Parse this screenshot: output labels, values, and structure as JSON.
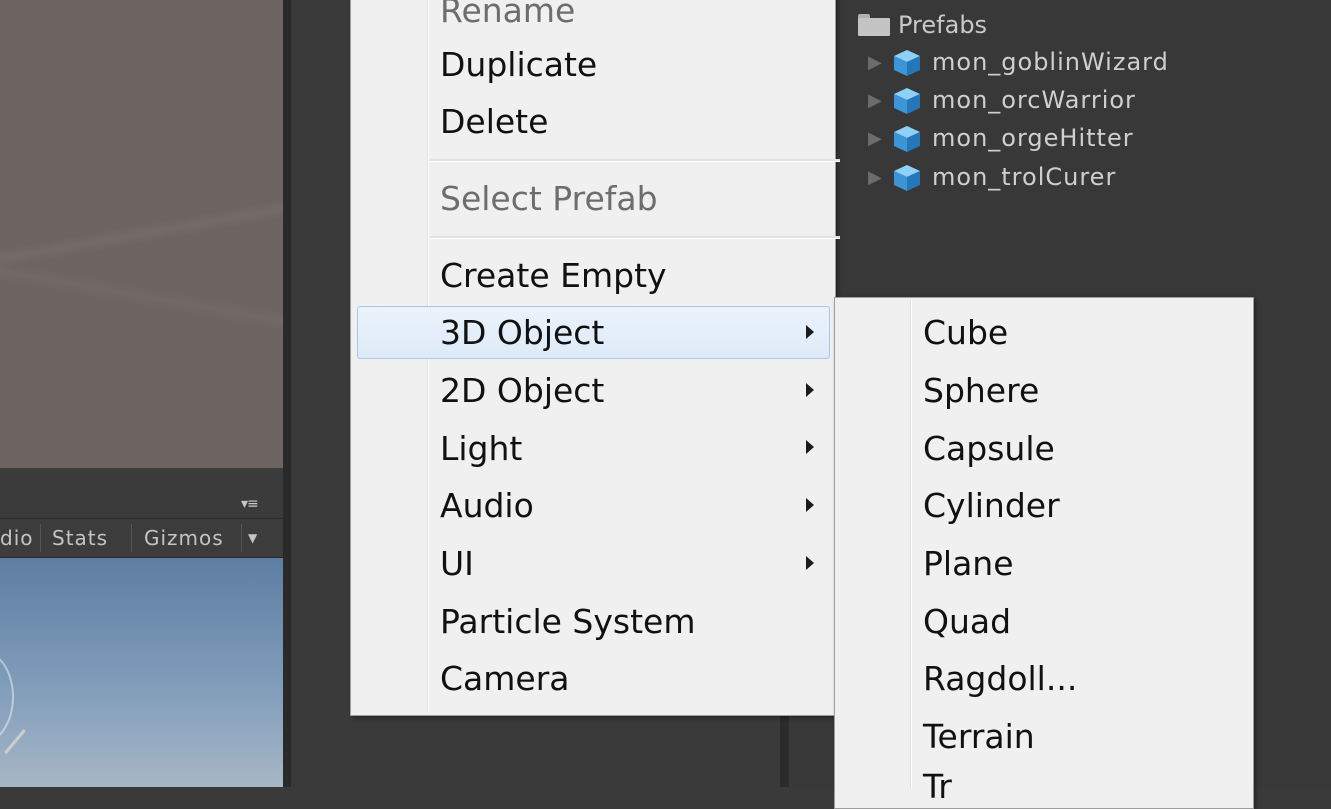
{
  "scene": {
    "toolbar": {
      "audio_partial": "dio",
      "stats_label": "Stats",
      "gizmos_label": "Gizmos"
    }
  },
  "hierarchy": {
    "folder_label": "Prefabs",
    "items": [
      {
        "label": "mon_goblinWizard"
      },
      {
        "label": "mon_orcWarrior"
      },
      {
        "label": "mon_orgeHitter"
      },
      {
        "label": "mon_trolCurer"
      }
    ]
  },
  "context_menu": {
    "rename": "Rename",
    "duplicate": "Duplicate",
    "delete": "Delete",
    "select_prefab": "Select Prefab",
    "create_empty": "Create Empty",
    "object_3d": "3D Object",
    "object_2d": "2D Object",
    "light": "Light",
    "audio": "Audio",
    "ui": "UI",
    "particle_system": "Particle System",
    "camera": "Camera"
  },
  "submenu_3d": {
    "items": [
      "Cube",
      "Sphere",
      "Capsule",
      "Cylinder",
      "Plane",
      "Quad",
      "Ragdoll...",
      "Terrain"
    ],
    "partial_next": "Tr"
  },
  "colors": {
    "menu_bg": "#f0f0f0",
    "highlight_border": "#a8c7ec",
    "editor_dark": "#383838",
    "prefab_cube": "#4aa3e0"
  }
}
